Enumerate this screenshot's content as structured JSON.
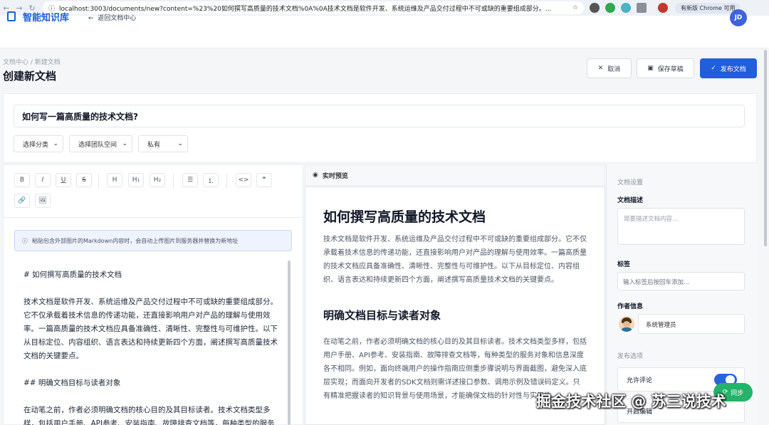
{
  "browser": {
    "url": "localhost:3003/documents/new?content=%23%20如何撰写高质量的技术文档%0A%0A技术文档是软件开发、系统运维及产品交付过程中不可或缺的重要组成部分。...",
    "update_label": "有新版 Chrome 可用"
  },
  "app": {
    "name": "智能知识库",
    "back": "返回文档中心",
    "avatar": "JD"
  },
  "page": {
    "breadcrumb": "文档中心 / 新建文档",
    "title": "创建新文档",
    "cancel": "取消",
    "save": "保存草稿",
    "publish": "发布文档"
  },
  "doc": {
    "title_value": "如何写一篇高质量的技术文档?",
    "category": "选择分类",
    "team": "选择团队空间",
    "visibility": "私有"
  },
  "editor": {
    "toolbar": [
      "B",
      "I",
      "U",
      "S",
      "H",
      "H₁",
      "H₂",
      "☰",
      "⒈",
      "<>",
      "❞",
      "🔗",
      "🖼"
    ],
    "notice": "粘贴包含外部图片的Markdown内容时，会自动上传图片到服务器并替换为新地址",
    "lines": [
      "# 如何撰写高质量的技术文档",
      "技术文档是软件开发、系统运维及产品交付过程中不可或缺的重要组成部分。它不仅承载着技术信息的传递功能，还直接影响用户对产品的理解与使用效率。一篇高质量的技术文档应具备准确性、清晰性、完整性与可维护性。以下从目标定位、内容组织、语言表达和持续更新四个方面，阐述撰写高质量技术文档的关键要点。",
      "## 明确文档目标与读者对象",
      "在动笔之前，作者必须明确文档的核心目的及其目标读者。技术文档类型多样，包括用户手册、API参考、安装指南、故障排查文档等，每种类型的服务对象"
    ]
  },
  "preview": {
    "header": "实时预览",
    "h1": "如何撰写高质量的技术文档",
    "p1": "技术文档是软件开发、系统运维及产品交付过程中不可或缺的重要组成部分。它不仅承载着技术信息的传递功能，还直接影响用户对产品的理解与使用效率。一篇高质量的技术文档应具备准确性、清晰性、完整性与可维护性。以下从目标定位、内容组织、语言表达和持续更新四个方面，阐述撰写高质量技术文档的关键要点。",
    "h2": "明确文档目标与读者对象",
    "p2": "在动笔之前，作者必须明确文档的核心目的及其目标读者。技术文档类型多样，包括用户手册、API参考、安装指南、故障排查文档等，每种类型的服务对象和信息深度各不相同。例如，面向终端用户的操作指南应侧重步骤说明与界面截图，避免深入底层实现；而面向开发者的SDK文档则需详述接口参数、调用示例及错误码定义。只有精准把握读者的知识背景与使用场景，才能确保文档的针对性与实用性。"
  },
  "settings": {
    "section": "文档设置",
    "desc_label": "文档描述",
    "desc_placeholder": "简要描述文档内容...",
    "tags_label": "标签",
    "tags_placeholder": "输入标签后按回车添加...",
    "author_label": "作者信息",
    "author_name": "系统管理员",
    "publish_section": "发布选项",
    "allow_comments": "允许评论",
    "allow_comments_on": true,
    "second_option": "开启编辑"
  },
  "overlay": {
    "sync": "同步",
    "watermark": "掘金技术社区 @ 苏三说技术"
  }
}
